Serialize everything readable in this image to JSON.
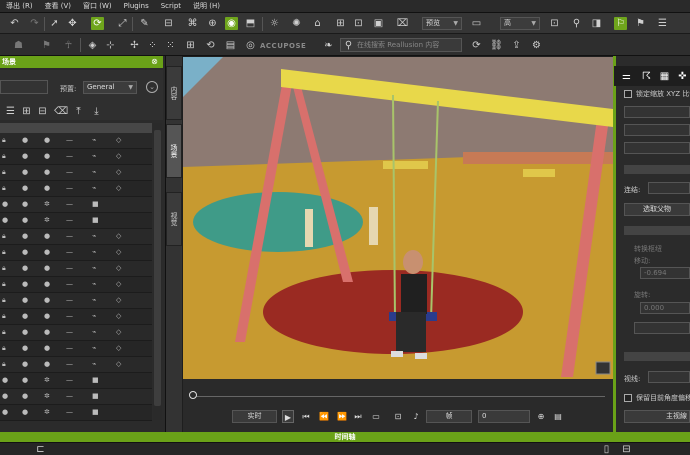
{
  "menu": [
    "導出 (R)",
    "查看 (V)",
    "窗口 (W)",
    "Plugins",
    "Script",
    "说明 (H)"
  ],
  "toolbar": {
    "preview_combo": "预览",
    "quality_combo": "高",
    "logo_text": "ACCUPOSE",
    "search_placeholder": "在线搜索 Reallusion 内容"
  },
  "left_panel": {
    "title": "场景",
    "preset_label": "预置:",
    "preset_value": "General"
  },
  "vertical_tabs": [
    "内容",
    "场景",
    "视觉"
  ],
  "playback": {
    "realtime_label": "实时",
    "frame_combo": "帧",
    "frame_value": "0"
  },
  "right_panel": {
    "lock_scale_label": "锁定缩放 XYZ 比例",
    "link_label": "连结:",
    "select_parent_btn": "选取父物",
    "pivot_label": "转换枢纽",
    "move_label": "移动:",
    "move_value": "-0.694",
    "rotate_label": "旋转:",
    "rotate_value": "0.000",
    "view_label": "视线:",
    "keep_offset_label": "保留目前角度偏移(",
    "main_view_btn": "主视線"
  },
  "timeline": {
    "title": "时间轴"
  },
  "colors": {
    "accent": "#6aa218"
  }
}
